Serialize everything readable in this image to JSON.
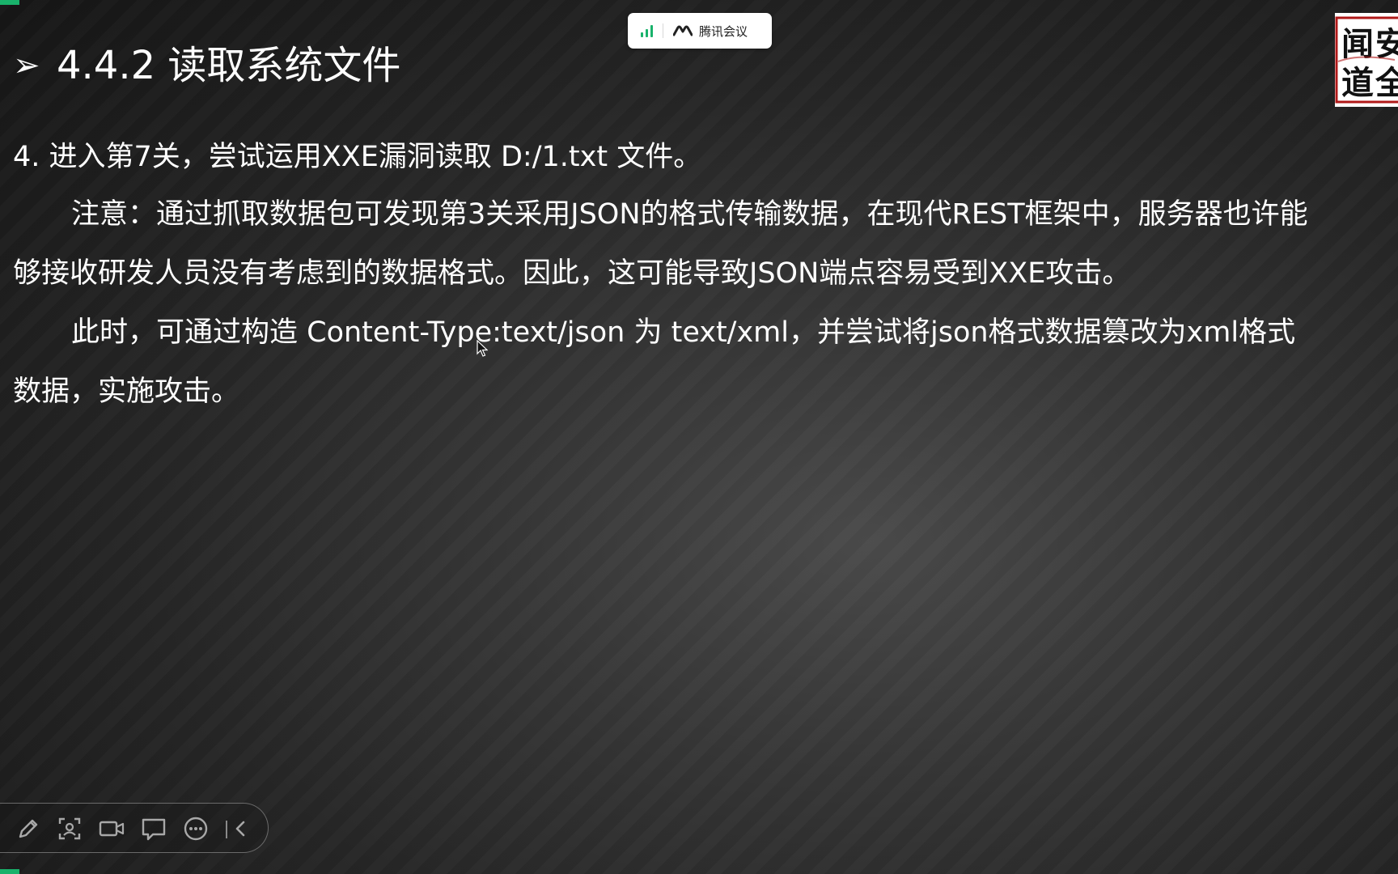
{
  "slide": {
    "title": "4.4.2 读取系统文件",
    "title_bullet_icon": "arrow-bullet-icon",
    "paragraphs": [
      "4. 进入第7关，尝试运用XXE漏洞读取 D:/1.txt 文件。",
      "注意：通过抓取数据包可发现第3关采用JSON的格式传输数据，在现代REST框架中，服务器也许能够接收研发人员没有考虑到的数据格式。因此，这可能导致JSON端点容易受到XXE攻击。",
      "此时，可通过构造 Content-Type:text/json 为 text/xml，并尝试将json格式数据篡改为xml格式数据，实施攻击。"
    ]
  },
  "meeting_status": {
    "app_name": "腾讯会议",
    "signal_icon": "signal-bars-icon",
    "logo_icon": "tencent-meeting-logo-icon"
  },
  "seal_logo": {
    "text": "闻道安全"
  },
  "toolbar": {
    "buttons": [
      {
        "name": "pen-icon"
      },
      {
        "name": "screenshot-icon"
      },
      {
        "name": "camera-icon"
      },
      {
        "name": "chat-icon"
      },
      {
        "name": "more-icon"
      },
      {
        "name": "collapse-icon"
      }
    ]
  },
  "colors": {
    "text": "#ffffff",
    "accent_green": "#19b26b",
    "background_dark": "#1c1c1c"
  }
}
